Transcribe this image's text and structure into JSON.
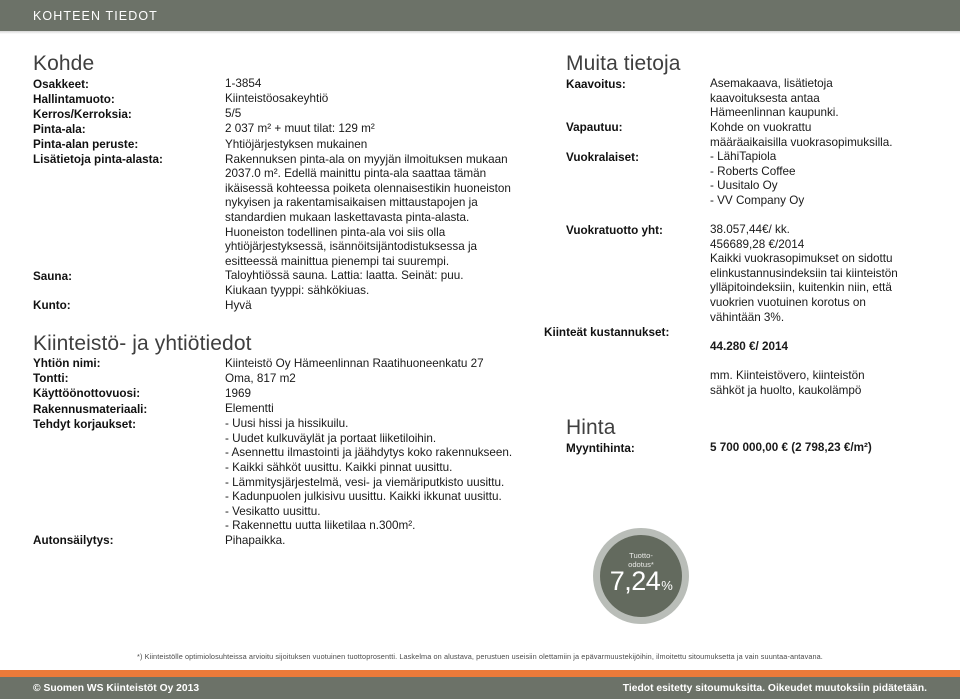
{
  "topbar": {
    "title": "KOHTEEN TIEDOT"
  },
  "colors": {
    "header_bg": "#6c7268",
    "footer_bg": "#6c7268",
    "accent_orange": "#ec7a3a",
    "badge_ring": "#b9bdb8",
    "badge_fill": "#636a5e"
  },
  "left": {
    "section1_title": "Kohde",
    "rows1": [
      {
        "label": "Osakkeet:",
        "value": "1-3854"
      },
      {
        "label": "Hallintamuoto:",
        "value": "Kiinteistöosakeyhtiö"
      },
      {
        "label": "Kerros/Kerroksia:",
        "value": "5/5"
      },
      {
        "label": "Pinta-ala:",
        "value": "2 037 m² + muut tilat: 129 m²"
      },
      {
        "label": "Pinta-alan peruste:",
        "value": "Yhtiöjärjestyksen mukainen"
      },
      {
        "label": "Lisätietoja pinta-alasta:",
        "value": "Rakennuksen pinta-ala on myyjän ilmoituksen mukaan\n2037.0 m². Edellä mainittu pinta-ala saattaa tämän\nikäisessä kohteessa poiketa olennaisestikin huoneiston\nnykyisen ja rakentamisaikaisen mittaustapojen ja\nstandardien mukaan laskettavasta pinta-alasta.\nHuoneiston todellinen pinta-ala voi siis olla\nyhtiöjärjestyksessä, isännöitsijäntodistuksessa ja\nesitteessä mainittua pienempi tai suurempi."
      },
      {
        "label": "Sauna:",
        "value": "Taloyhtiössä sauna. Lattia: laatta. Seinät: puu.\nKiukaan tyyppi: sähkökiuas."
      },
      {
        "label": "Kunto:",
        "value": "Hyvä"
      }
    ],
    "section2_title": "Kiinteistö- ja yhtiötiedot",
    "rows2": [
      {
        "label": "Yhtiön nimi:",
        "value": "Kiinteistö Oy Hämeenlinnan Raatihuoneenkatu 27"
      },
      {
        "label": "Tontti:",
        "value": "Oma, 817 m2"
      },
      {
        "label": "Käyttöönottovuosi:",
        "value": "1969"
      },
      {
        "label": "Rakennusmateriaali:",
        "value": "Elementti"
      },
      {
        "label": "Tehdyt korjaukset:",
        "value": "- Uusi hissi ja hissikuilu.\n- Uudet kulkuväylät ja portaat liiketiloihin.\n- Asennettu ilmastointi ja jäähdytys koko rakennukseen.\n- Kaikki sähköt uusittu. Kaikki pinnat uusittu.\n- Lämmitysjärjestelmä, vesi- ja viemäriputkisto uusittu.\n- Kadunpuolen julkisivu uusittu. Kaikki ikkunat uusittu.\n- Vesikatto uusittu.\n- Rakennettu uutta liiketilaa n.300m²."
      },
      {
        "label": "Autonsäilytys:",
        "value": "Pihapaikka."
      }
    ]
  },
  "right": {
    "section1_title": "Muita tietoja",
    "rows1": [
      {
        "label": "Kaavoitus:",
        "value": "Asemakaava, lisätietoja\nkaavoituksesta antaa\nHämeenlinnan kaupunki."
      },
      {
        "label": "Vapautuu:",
        "value": "Kohde on vuokrattu\nmääräaikaisilla vuokrasopimuksilla."
      },
      {
        "label": "Vuokralaiset:",
        "value": "- LähiTapiola\n- Roberts Coffee\n- Uusitalo Oy\n- VV Company Oy"
      }
    ],
    "rows2": [
      {
        "label": "Vuokratuotto yht:",
        "value": "38.057,44€/ kk.\n456689,28 €/2014\nKaikki vuokrasopimukset on sidottu\nelinkustannusindeksiin tai kiinteistön\nylläpitoindeksiin, kuitenkin niin, että\nvuokrien vuotuinen korotus on\nvähintään 3%."
      },
      {
        "label": "Kiinteät kustannukset:",
        "value_bold": "44.280 €/ 2014",
        "value": "mm. Kiinteistövero, kiinteistön\nsähköt ja huolto, kaukolämpö"
      }
    ],
    "section2_title": "Hinta",
    "price_label": "Myyntihinta:",
    "price_value": "5 700 000,00 € (2 798,23 €/m²)"
  },
  "badge": {
    "caption": "Tuotto-\nodotus*",
    "value": "7,24",
    "unit": "%"
  },
  "footnote": "*) Kiinteistölle optimiolosuhteissa arvioitu sijoituksen vuotuinen tuottoprosentti. Laskelma on alustava, perustuen useisiin olettamiin ja epävarmuustekijöihin, ilmoitettu sitoumuksetta ja vain suuntaa-antavana.",
  "footer": {
    "left": "© Suomen WS Kiinteistöt Oy 2013",
    "right": "Tiedot esitetty sitoumuksitta. Oikeudet muutoksiin pidätetään."
  }
}
